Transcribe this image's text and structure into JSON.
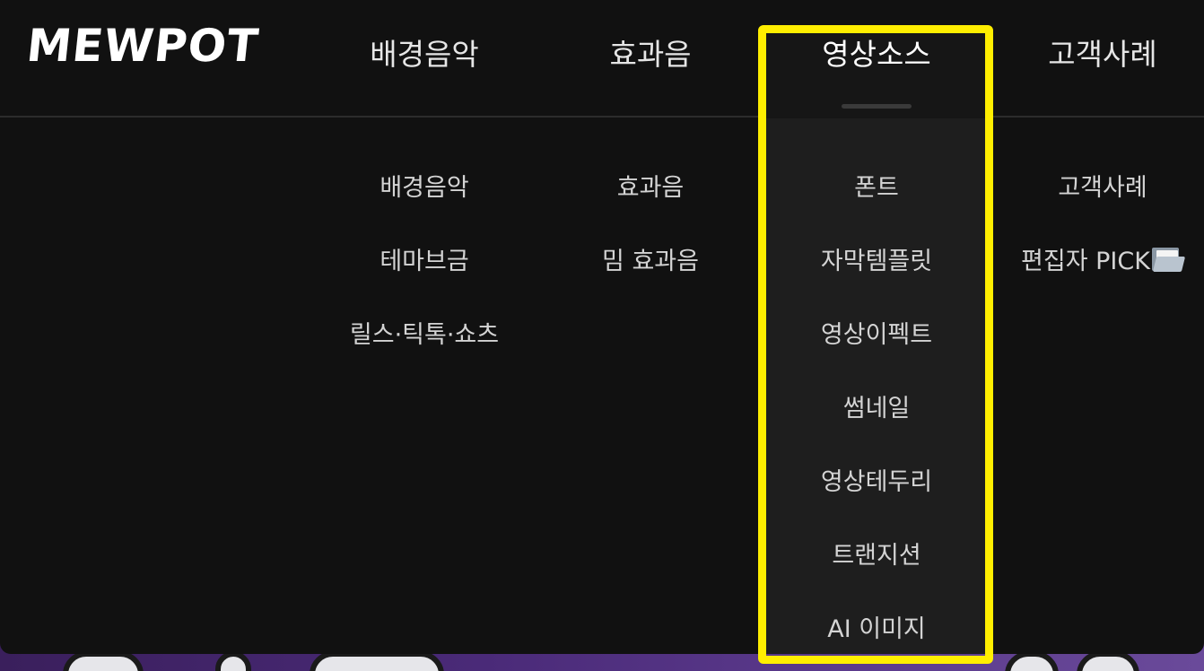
{
  "brand": {
    "logo_text": "MEWPOT"
  },
  "nav": [
    {
      "label": "배경음악"
    },
    {
      "label": "효과음"
    },
    {
      "label": "영상소스"
    },
    {
      "label": "고객사례"
    }
  ],
  "active_nav_index": 2,
  "submenus": {
    "music": [
      "배경음악",
      "테마브금",
      "릴스·틱톡·쇼츠"
    ],
    "sfx": [
      "효과음",
      "밈 효과음"
    ],
    "video_source": [
      "폰트",
      "자막템플릿",
      "영상이펙트",
      "썸네일",
      "영상테두리",
      "트랜지션",
      "AI 이미지"
    ],
    "cases": [
      "고객사례",
      "편집자 PICK"
    ]
  },
  "icons": {
    "editor_pick_icon": "open-folder-icon"
  },
  "colors": {
    "background": "#111111",
    "active_column": "#1e1e1e",
    "highlight": "#ffee00",
    "text": "#d4d4d4"
  }
}
